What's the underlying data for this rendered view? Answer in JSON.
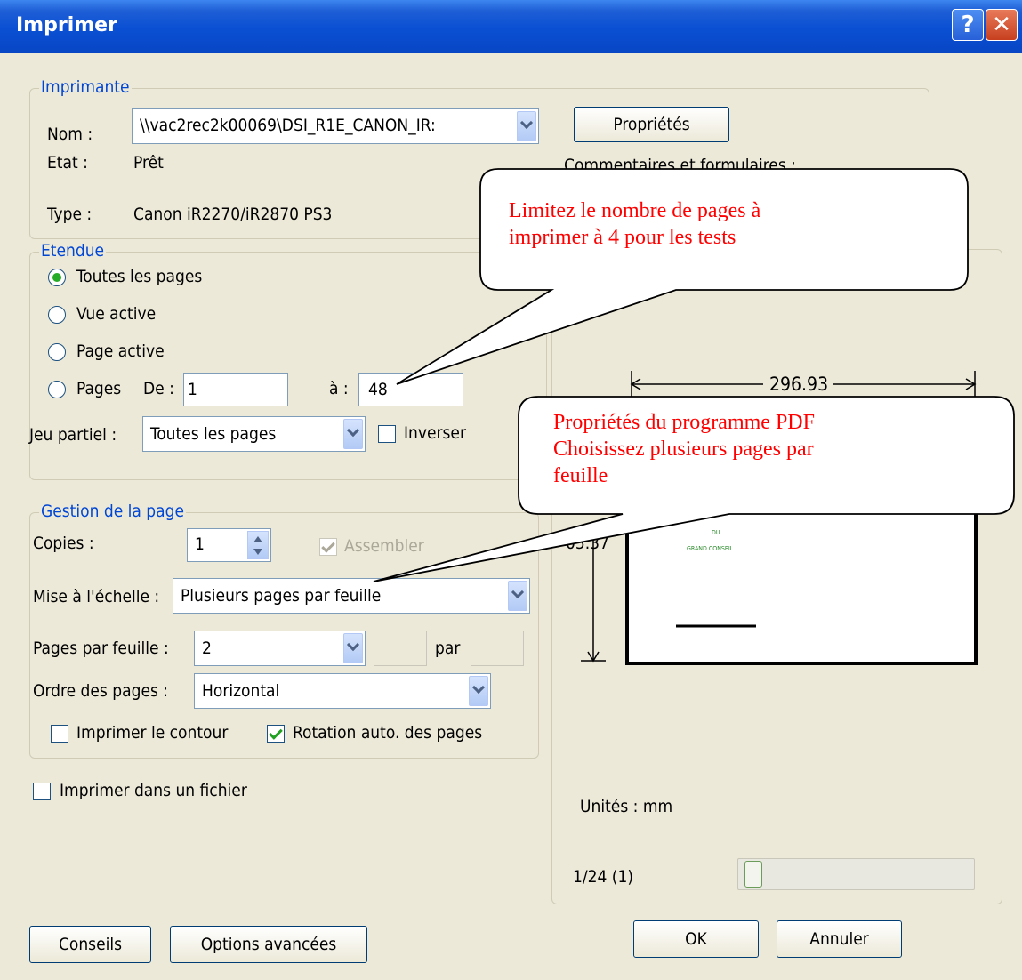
{
  "window": {
    "title": "Imprimer",
    "help_glyph": "?",
    "close_glyph": "✕"
  },
  "printer": {
    "group_label": "Imprimante",
    "name_label": "Nom :",
    "name_value": "\\\\vac2rec2k00069\\DSI_R1E_CANON_IR:",
    "state_label": "Etat :",
    "state_value": "Prêt",
    "type_label": "Type :",
    "type_value": "Canon iR2270/iR2870 PS3",
    "properties_button": "Propriétés",
    "comments_label": "Commentaires et formulaires :"
  },
  "range": {
    "group_label": "Etendue",
    "all_pages": "Toutes les pages",
    "current_view": "Vue active",
    "current_page": "Page active",
    "pages": "Pages",
    "from_label": "De :",
    "from_value": "1",
    "to_label": "à :",
    "to_value": "48",
    "subset_label": "Jeu partiel :",
    "subset_value": "Toutes les pages",
    "reverse_label": "Inverser",
    "selected": "all_pages"
  },
  "page_handling": {
    "group_label": "Gestion de la page",
    "copies_label": "Copies :",
    "copies_value": "1",
    "collate_label": "Assembler",
    "scaling_label": "Mise à l'échelle :",
    "scaling_value": "Plusieurs pages par feuille",
    "pages_per_sheet_label": "Pages par feuille :",
    "pages_per_sheet_value": "2",
    "by_label": "par",
    "page_order_label": "Ordre des pages :",
    "page_order_value": "Horizontal",
    "print_borders_label": "Imprimer le contour",
    "auto_rotate_label": "Rotation auto. des pages",
    "print_borders_checked": false,
    "auto_rotate_checked": true,
    "collate_checked": true
  },
  "print_to_file": {
    "label": "Imprimer dans un fichier",
    "checked": false
  },
  "preview": {
    "width_dim": "296.93",
    "height_dim": "05.37",
    "page_text_1": "DU",
    "page_text_2": "GRAND CONSEIL",
    "units_label": "Unités : mm",
    "page_indicator": "1/24 (1)",
    "slider_position": 0.03
  },
  "buttons": {
    "tips": "Conseils",
    "advanced": "Options avancées",
    "ok": "OK",
    "cancel": "Annuler"
  },
  "callouts": {
    "first_line1": "Limitez le nombre de pages à",
    "first_line2": "imprimer à 4 pour les tests",
    "second_line1": "Propriétés du programme PDF",
    "second_line2": "Choisissez plusieurs pages par",
    "second_line3": "feuille"
  }
}
